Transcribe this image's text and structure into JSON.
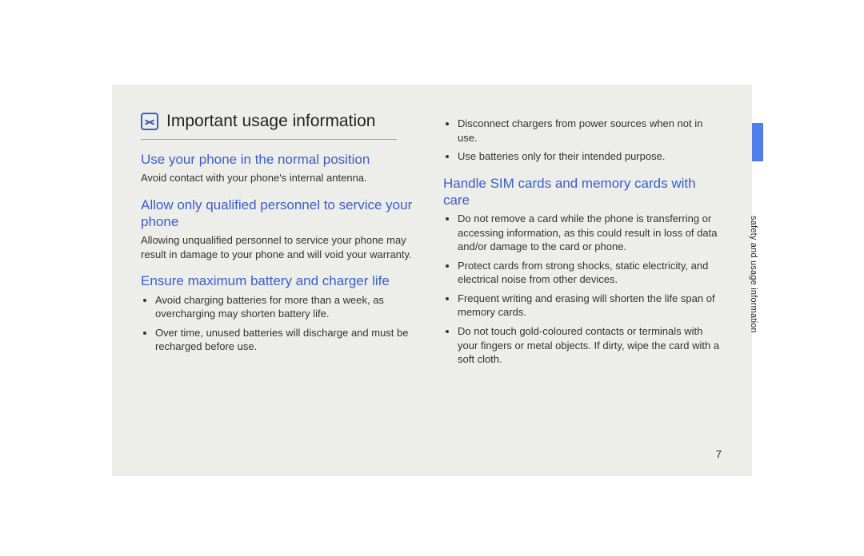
{
  "page": {
    "title": "Important usage information",
    "pageNumber": "7",
    "sideLabel": "safety and usage information"
  },
  "left": {
    "sec1": {
      "heading": "Use your phone in the normal position",
      "body": "Avoid contact with your phone's internal antenna."
    },
    "sec2": {
      "heading": "Allow only qualified personnel to service your phone",
      "body": "Allowing unqualified personnel to service your phone may result in damage to your phone and will void your warranty."
    },
    "sec3": {
      "heading": "Ensure maximum battery and charger life",
      "bullets": [
        "Avoid charging batteries for more than a week, as overcharging may shorten battery life.",
        "Over time, unused batteries will discharge and must be recharged before use."
      ]
    }
  },
  "right": {
    "topBullets": [
      "Disconnect chargers from power sources when not in use.",
      "Use batteries only for their intended purpose."
    ],
    "sec4": {
      "heading": "Handle SIM cards and memory cards with care",
      "bullets": [
        "Do not remove a card while the phone is transferring or accessing information, as this could result in loss of data and/or damage to the card or phone.",
        "Protect cards from strong shocks, static electricity, and electrical noise from other devices.",
        "Frequent writing and erasing will shorten the life span of memory cards.",
        "Do not touch gold-coloured contacts or terminals with your fingers or metal objects. If dirty, wipe the card with a soft cloth."
      ]
    }
  }
}
